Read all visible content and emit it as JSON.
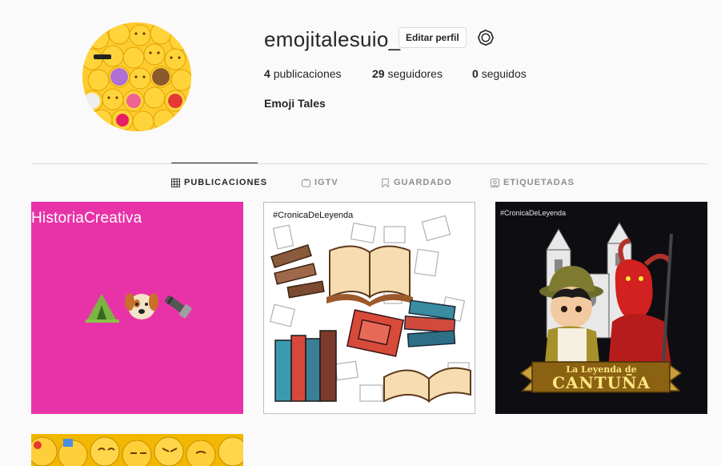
{
  "profile": {
    "username": "emojitalesuio_",
    "edit_label": "Editar perfil",
    "full_name": "Emoji Tales",
    "stats": {
      "posts_count": "4",
      "posts_label": "publicaciones",
      "followers_count": "29",
      "followers_label": "seguidores",
      "following_count": "0",
      "following_label": "seguidos"
    }
  },
  "tabs": [
    {
      "label": "PUBLICACIONES",
      "icon": "grid-icon",
      "active": true
    },
    {
      "label": "IGTV",
      "icon": "tv-icon",
      "active": false
    },
    {
      "label": "GUARDADO",
      "icon": "bookmark-icon",
      "active": false
    },
    {
      "label": "ETIQUETADAS",
      "icon": "tag-photo-icon",
      "active": false
    }
  ],
  "posts": [
    {
      "caption": "HistoriaCreativa",
      "bg": "#e833a8"
    },
    {
      "caption": "#CronicaDeLeyenda",
      "bg": "#ffffff"
    },
    {
      "caption": "#CronicaDeLeyenda",
      "banner_top": "La Leyenda de",
      "banner_main": "CANTUÑA",
      "bg": "#0e0d12"
    },
    {
      "caption": "",
      "bg": "#f2b700"
    }
  ],
  "colors": {
    "text": "#262626",
    "muted": "#8e8e8e",
    "border": "#dbdbdb",
    "background": "#fafafa"
  }
}
